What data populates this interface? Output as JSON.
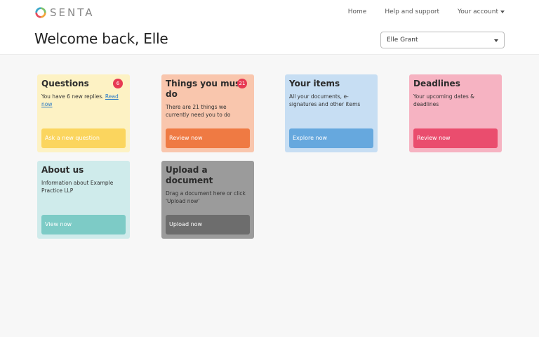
{
  "brand": {
    "name": "SENTA"
  },
  "nav": {
    "home": "Home",
    "help": "Help and support",
    "account": "Your account"
  },
  "page": {
    "title": "Welcome back, Elle"
  },
  "user_select": {
    "value": "Elle Grant"
  },
  "tiles": {
    "questions": {
      "title": "Questions",
      "badge": "6",
      "text": "You have 6 new replies.",
      "link": "Read now",
      "button": "Ask a new question"
    },
    "things": {
      "title": "Things you must do",
      "badge": "21",
      "text": "There are 21 things we currently need you to do",
      "button": "Review now"
    },
    "items": {
      "title": "Your items",
      "text": "All your documents, e-signatures and other items",
      "button": "Explore now"
    },
    "deadlines": {
      "title": "Deadlines",
      "text": "Your upcoming dates & deadlines",
      "button": "Review now"
    },
    "about": {
      "title": "About us",
      "text": "Information about Example Practice LLP",
      "button": "View now"
    },
    "upload": {
      "title": "Upload a document",
      "text": "Drag a document here or click 'Upload now'",
      "button": "Upload now"
    }
  },
  "colors": {
    "questions": "#fbd55e",
    "things": "#ef7a43",
    "items": "#66a8de",
    "deadlines": "#ea4d6e",
    "about": "#7dcbc6",
    "upload": "#6d6d6d",
    "badge": "#e73a53"
  }
}
